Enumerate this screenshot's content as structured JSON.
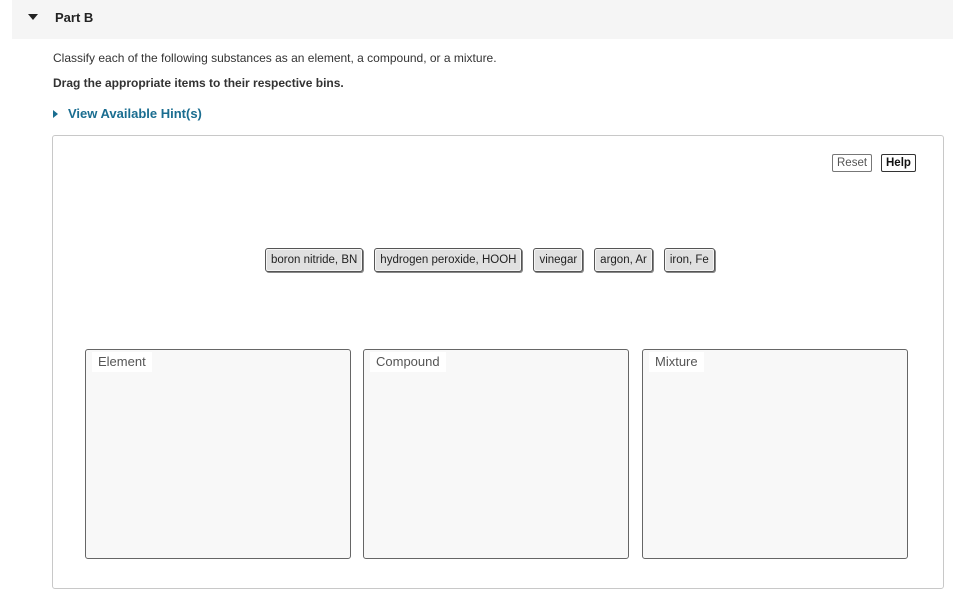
{
  "part": {
    "title": "Part B"
  },
  "question": {
    "instruction": "Classify each of the following substances as an element, a compound, or a mixture.",
    "drag_instruction": "Drag the appropriate items to their respective bins.",
    "hint_link": "View Available Hint(s)"
  },
  "toolbar": {
    "reset_label": "Reset",
    "help_label": "Help"
  },
  "items": [
    "boron nitride, BN",
    "hydrogen peroxide, HOOH",
    "vinegar",
    "argon, Ar",
    "iron, Fe"
  ],
  "bins": [
    "Element",
    "Compound",
    "Mixture"
  ],
  "colors": {
    "link": "#1a6d90",
    "header_bg": "#f5f5f5",
    "chip_bg": "#e0e0e0",
    "bin_bg": "#f8f8f8"
  }
}
